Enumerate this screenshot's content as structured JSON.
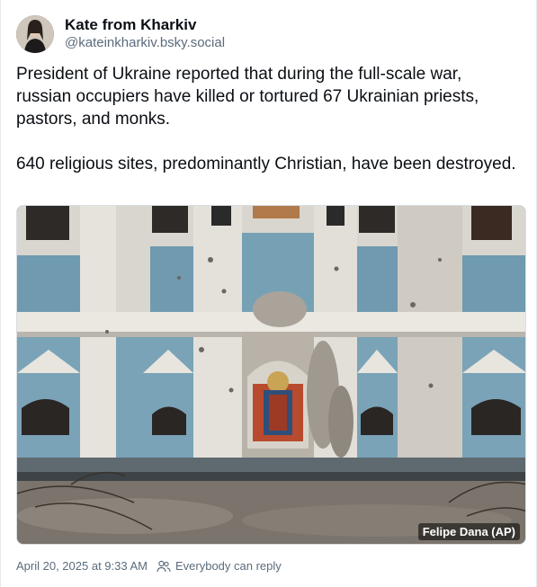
{
  "author": {
    "display_name": "Kate from Kharkiv",
    "handle": "@kateinkharkiv.bsky.social"
  },
  "post": {
    "paragraphs": [
      "President of Ukraine reported that during the full-scale war, russian occupiers have killed or tortured 67 Ukrainian priests, pastors, and monks.",
      "640 religious sites, predominantly Christian, have been destroyed."
    ]
  },
  "media": {
    "icon": "photo-of-damaged-church",
    "credit": "Felipe Dana (AP)"
  },
  "meta": {
    "timestamp": "April 20, 2025 at 9:33 AM",
    "reply_setting": "Everybody can reply",
    "reply_icon": "people-icon"
  },
  "colors": {
    "text": "#0b0f14",
    "secondary_text": "#5b6b7c",
    "border": "#e6e9ee"
  }
}
